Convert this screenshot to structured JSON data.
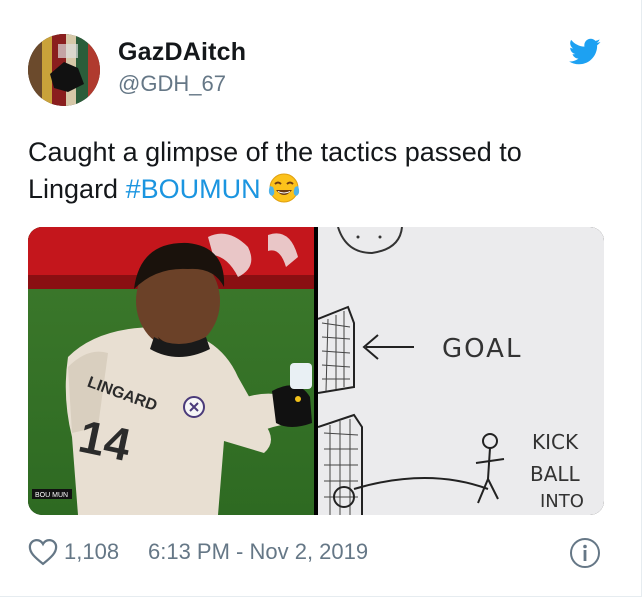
{
  "tweet": {
    "author": {
      "display_name": "GazDAitch",
      "handle": "@GDH_67",
      "avatar_icon": "avatar-photo"
    },
    "text_before": "Caught a glimpse of the tactics passed to Lingard",
    "hashtag": "#BOUMUN",
    "emoji": "face-with-tears-of-joy",
    "media": {
      "left_photo": {
        "shirt_number": "14",
        "shirt_name": "LINGARD",
        "tv_badge": "BOU MUN"
      },
      "right_photo": {
        "label_goal": "GOAL",
        "label_kick": "KICK",
        "label_ball": "BALL",
        "label_into": "INTO"
      }
    },
    "likes": "1,108",
    "timestamp": "6:13 PM - Nov 2, 2019"
  },
  "colors": {
    "link": "#1b95e0",
    "muted": "#657786",
    "text": "#14171a",
    "twitter_blue": "#1da1f2"
  }
}
